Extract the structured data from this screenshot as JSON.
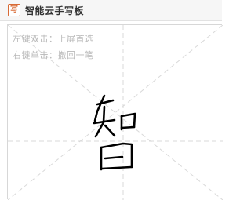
{
  "window": {
    "title": "智能云手写板",
    "icon": "handwriting-pad-icon",
    "icon_glyph": "写"
  },
  "pad": {
    "hint_left": "左键双击：上屏首选",
    "hint_right": "右键单击：撤回一笔",
    "handwritten_character": "智"
  },
  "colors": {
    "accent": "#d86a35",
    "guide": "#d9d9d9",
    "hint": "#b9b9b9",
    "ink": "#000000"
  }
}
